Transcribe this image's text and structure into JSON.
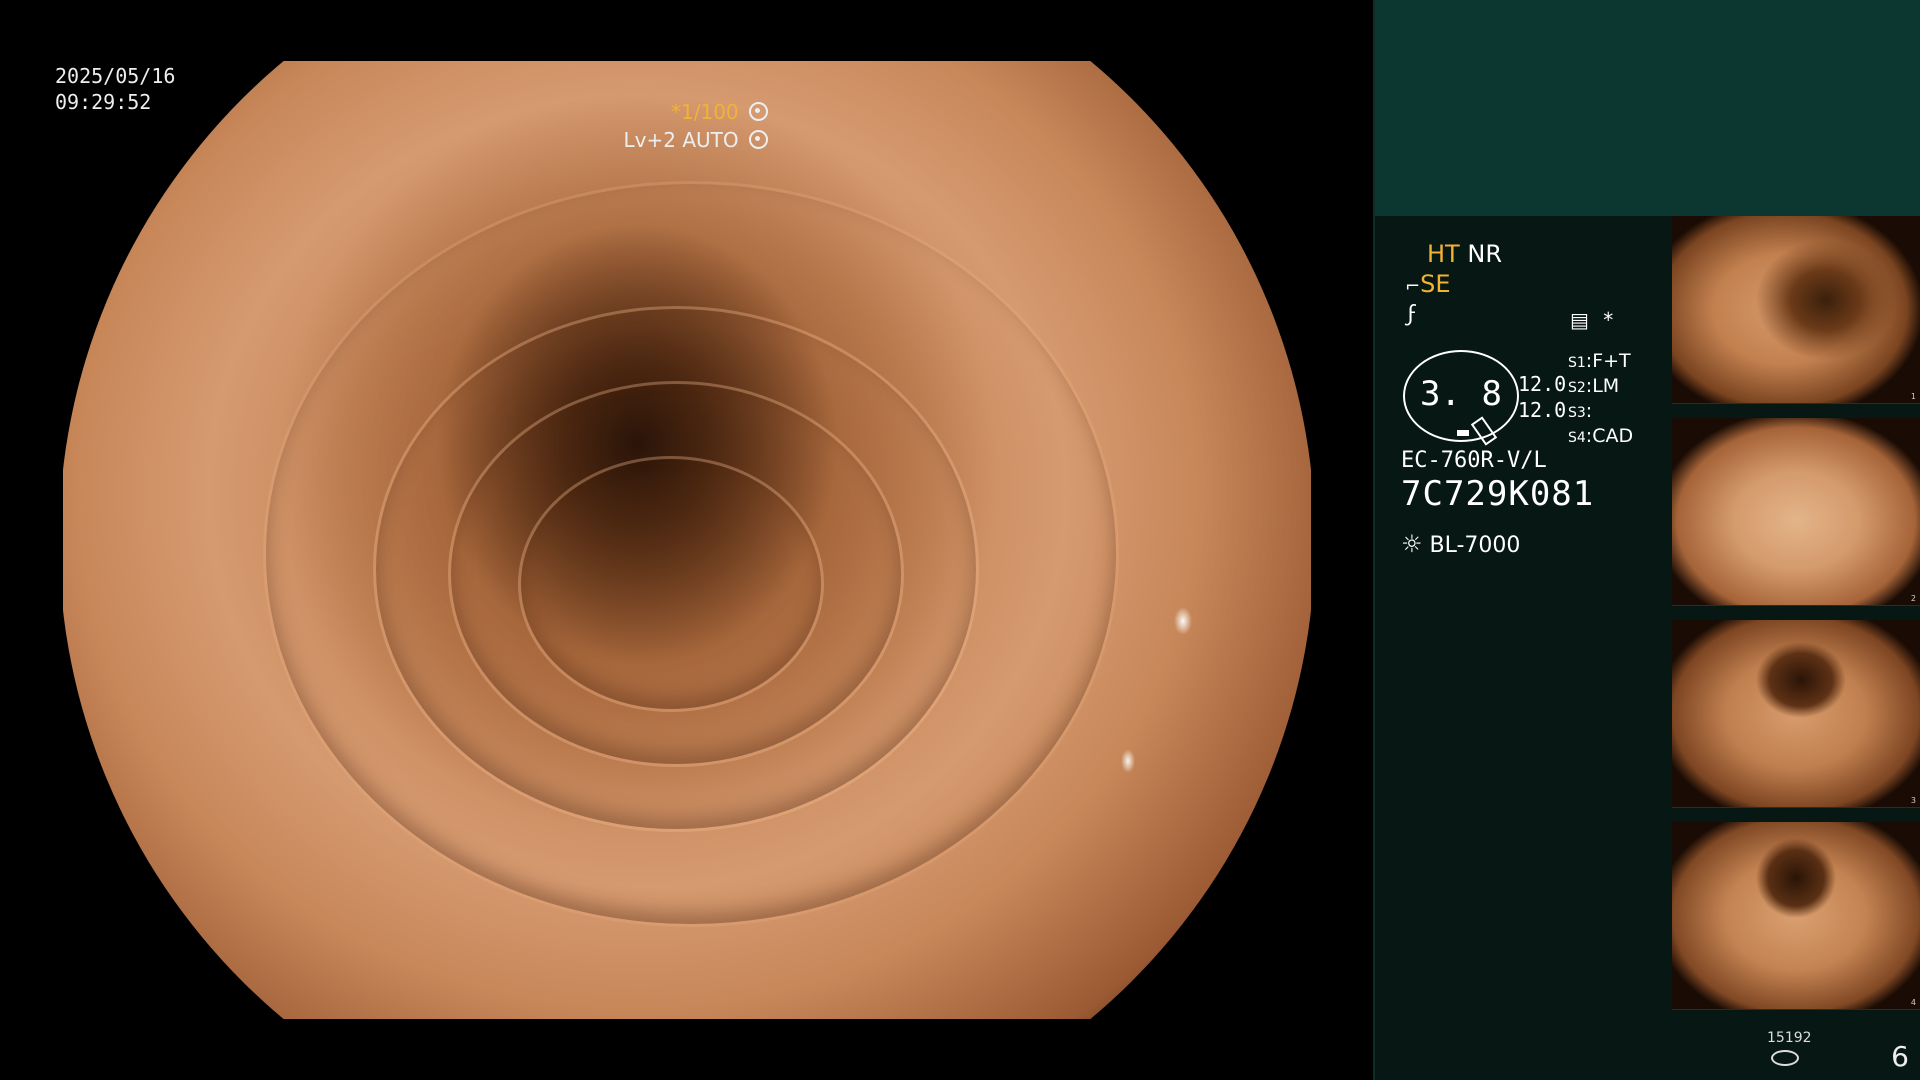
{
  "overlay": {
    "date": "2025/05/16",
    "time": "09:29:52",
    "shutter": "*1/100",
    "level": "Lv+2",
    "exposure_mode": "AUTO"
  },
  "panel": {
    "ht": "HT",
    "nr": "NR",
    "se": "SE",
    "asterisk": "*",
    "dial_value": "3. 8",
    "value_top": "12.0",
    "value_bottom": "12.0",
    "s1_label": "S1",
    "s1_value": "F+T",
    "s2_label": "S2",
    "s2_value": "LM",
    "s3_label": "S3",
    "s3_value": "",
    "s4_label": "S4",
    "s4_value": "CAD",
    "scope_model": "EC-760R-V/L",
    "scope_serial": "7C729K081",
    "light_source": "BL-7000",
    "image_count": "15192",
    "page": "6"
  },
  "colors": {
    "accent": "#f2b233",
    "panel_bg": "#061714",
    "panel_top": "#0c3730"
  },
  "icons": [
    "shutter-icon",
    "auto-exposure-icon",
    "scope-icon",
    "gain-icon",
    "memo-icon",
    "light-source-icon",
    "disk-icon"
  ]
}
